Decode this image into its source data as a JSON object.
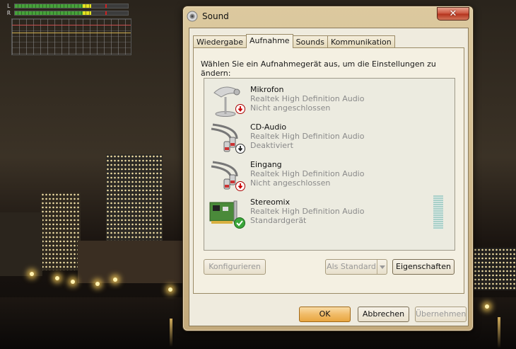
{
  "vu_meter": {
    "channels": [
      {
        "label": "L",
        "level": 0.62
      },
      {
        "label": "R",
        "level": 0.64
      }
    ]
  },
  "window": {
    "title": "Sound",
    "close_label": "✕"
  },
  "tabs": [
    {
      "label": "Wiedergabe",
      "active": false
    },
    {
      "label": "Aufnahme",
      "active": true
    },
    {
      "label": "Sounds",
      "active": false
    },
    {
      "label": "Kommunikation",
      "active": false
    }
  ],
  "instruction": "Wählen Sie ein Aufnahmegerät aus, um die Einstellungen zu ändern:",
  "devices": [
    {
      "name": "Mikrofon",
      "driver": "Realtek High Definition Audio",
      "status": "Nicht angeschlossen",
      "icon": "microphone-icon",
      "badge": "unplugged-badge-icon"
    },
    {
      "name": "CD-Audio",
      "driver": "Realtek High Definition Audio",
      "status": "Deaktiviert",
      "icon": "audio-cable-icon",
      "badge": "disabled-badge-icon"
    },
    {
      "name": "Eingang",
      "driver": "Realtek High Definition Audio",
      "status": "Nicht angeschlossen",
      "icon": "audio-cable-icon",
      "badge": "unplugged-badge-icon"
    },
    {
      "name": "Stereomix",
      "driver": "Realtek High Definition Audio",
      "status": "Standardgerät",
      "icon": "sound-card-icon",
      "badge": "default-check-badge-icon"
    }
  ],
  "buttons": {
    "configure": "Konfigurieren",
    "set_default": "Als Standard",
    "properties": "Eigenschaften",
    "ok": "OK",
    "cancel": "Abbrechen",
    "apply": "Übernehmen"
  }
}
